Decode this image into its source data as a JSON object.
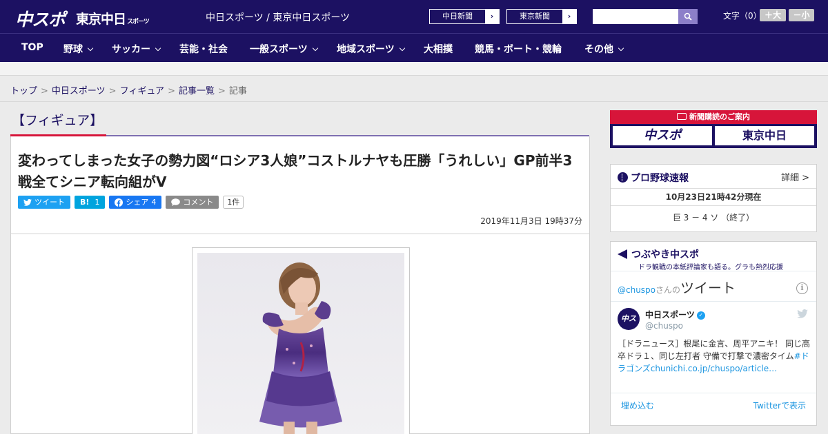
{
  "header": {
    "logo_chuspo": "中スポ",
    "logo_tokyo": "東京中日",
    "logo_tokyo_small": "スポーツ",
    "site_links": "中日スポーツ / 東京中日スポーツ",
    "paper_buttons": [
      "中日新聞",
      "東京新聞"
    ],
    "search_placeholder": "",
    "font_size_label": "文字（0）",
    "font_larger": "＋大",
    "font_smaller": "－小"
  },
  "nav": {
    "items": [
      "TOP",
      "野球",
      "サッカー",
      "芸能・社会",
      "一般スポーツ",
      "地域スポーツ",
      "大相撲",
      "競馬・ボート・競輪",
      "その他"
    ]
  },
  "breadcrumb": {
    "items": [
      "トップ",
      "中日スポーツ",
      "フィギュア",
      "記事一覧"
    ],
    "current": "記事",
    "separator": ">"
  },
  "category_heading": "【フィギュア】",
  "article": {
    "title": "変わってしまった女子の勢力図“ロシア3人娘”コストルナヤも圧勝「うれしい」GP前半3戦全てシニア転向組がV",
    "date": "2019年11月3日 19時37分",
    "share": {
      "tweet_label": "ツイート",
      "hatena_label": "B!",
      "hatena_count": "1",
      "facebook_label": "シェア",
      "facebook_count": "4",
      "comment_label": "コメント",
      "comment_count": "1件"
    }
  },
  "sidebar": {
    "subscription": {
      "title": "新聞購読のご案内",
      "logos": [
        "中スポ",
        "東京中日"
      ]
    },
    "baseball": {
      "title": "プロ野球速報",
      "detail_link": "詳細 >",
      "updated": "10月23日21時42分現在",
      "score": "巨  3 － 4  ソ  （終了）"
    },
    "tweets": {
      "title": "つぶやき中スポ",
      "subtitle": "ドラ観戦の本紙評論家も語る。グラも熱烈応援",
      "widget_handle": "@chuspo",
      "widget_handle_suffix": "さんの",
      "widget_title": "ツイート",
      "tweet_name": "中日スポーツ",
      "tweet_handle": "@chuspo",
      "tweet_text_plain": "［ドラニュース］根尾に金言、周平アニキ！ 同じ高卒ドラ１、同じ左打者 守備で打撃で濃密タイム",
      "tweet_text_link": "#ドラゴンズ",
      "tweet_url": "chunichi.co.jp/chuspo/article…",
      "embed_label": "埋め込む",
      "view_label": "Twitterで表示"
    }
  }
}
